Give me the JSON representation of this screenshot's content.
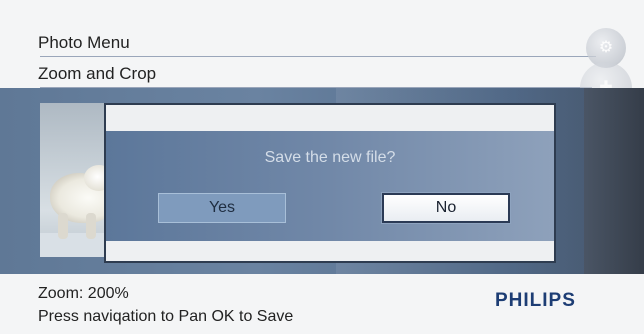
{
  "menu": {
    "title": "Photo Menu",
    "submenu": "Zoom and Crop"
  },
  "side_buttons": [
    {
      "icon": "photo-settings-icon"
    },
    {
      "icon": "dpad-icon"
    },
    {
      "icon": "menu-icon"
    }
  ],
  "dialog": {
    "message": "Save the new file?",
    "yes_label": "Yes",
    "no_label": "No",
    "selected": "No"
  },
  "status": {
    "zoom": "Zoom: 200%",
    "hint": "Press naviqation to Pan OK to Save"
  },
  "brand": "PHILIPS",
  "colors": {
    "brand": "#1d3d74",
    "dialog_body": "#5a7597",
    "highlight_border": "#2b3a55"
  }
}
